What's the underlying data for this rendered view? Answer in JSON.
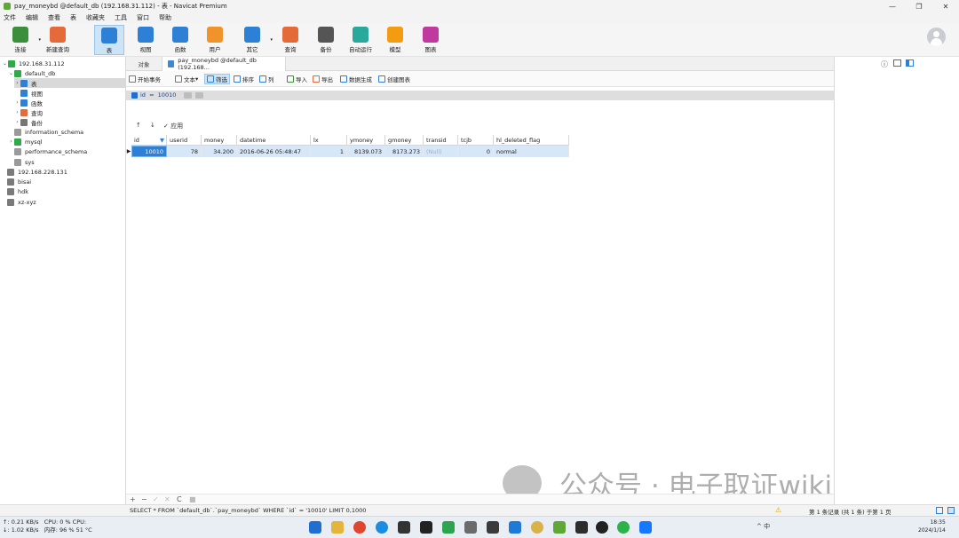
{
  "window": {
    "title": "pay_moneybd @default_db (192.168.31.112) - 表 - Navicat Premium",
    "min": "—",
    "max": "❐",
    "close": "✕"
  },
  "menu": [
    "文件",
    "编辑",
    "查看",
    "表",
    "收藏夹",
    "工具",
    "窗口",
    "帮助"
  ],
  "toolbar": [
    {
      "label": "连接",
      "icon": "plug-icon",
      "color": "#3c8e3c"
    },
    {
      "label": "新建查询",
      "icon": "new-query-icon",
      "color": "#e56a3a"
    },
    {
      "label": "表",
      "icon": "table-icon",
      "color": "#2e7fd6"
    },
    {
      "label": "视图",
      "icon": "view-icon",
      "color": "#2e7fd6"
    },
    {
      "label": "函数",
      "icon": "function-icon",
      "color": "#2e7fd6"
    },
    {
      "label": "用户",
      "icon": "user-icon",
      "color": "#f0932b"
    },
    {
      "label": "其它",
      "icon": "tools-icon",
      "color": "#2e7fd6"
    },
    {
      "label": "查询",
      "icon": "query-icon",
      "color": "#e56a3a"
    },
    {
      "label": "备份",
      "icon": "backup-icon",
      "color": "#555555"
    },
    {
      "label": "自动运行",
      "icon": "robot-icon",
      "color": "#2aa89b"
    },
    {
      "label": "模型",
      "icon": "model-icon",
      "color": "#f39c12"
    },
    {
      "label": "图表",
      "icon": "chart-icon",
      "color": "#c0399f"
    }
  ],
  "tree": [
    {
      "label": "192.168.31.112",
      "icon": "server-green-icon",
      "color": "#2eaa4a"
    },
    {
      "label": "default_db",
      "icon": "database-green-icon",
      "color": "#2eaa4a"
    },
    {
      "label": "表",
      "icon": "tables-icon",
      "color": "#2e7fd6"
    },
    {
      "label": "视图",
      "icon": "views-icon",
      "color": "#2e7fd6"
    },
    {
      "label": "函数",
      "icon": "functions-icon",
      "color": "#2e7fd6"
    },
    {
      "label": "查询",
      "icon": "queries-icon",
      "color": "#e56a3a"
    },
    {
      "label": "备份",
      "icon": "backups-icon",
      "color": "#777777"
    },
    {
      "label": "information_schema",
      "icon": "database-gray-icon",
      "color": "#9a9a9a"
    },
    {
      "label": "mysql",
      "icon": "database-green-icon",
      "color": "#2eaa4a"
    },
    {
      "label": "performance_schema",
      "icon": "database-gray-icon",
      "color": "#9a9a9a"
    },
    {
      "label": "sys",
      "icon": "database-gray-icon",
      "color": "#9a9a9a"
    },
    {
      "label": "192.168.228.131",
      "icon": "server-gray-icon",
      "color": "#7a7a7a"
    },
    {
      "label": "bisai",
      "icon": "server-gray-icon",
      "color": "#7a7a7a"
    },
    {
      "label": "hdk",
      "icon": "server-gray-icon",
      "color": "#7a7a7a"
    },
    {
      "label": "xz-xyz",
      "icon": "server-gray-icon",
      "color": "#7a7a7a"
    }
  ],
  "tabs": {
    "objects": "对象",
    "main": "pay_moneybd @default_db (192.168..."
  },
  "subtoolbar": [
    "开始事务",
    "文本",
    "筛选",
    "排序",
    "列",
    "导入",
    "导出",
    "数据生成",
    "创建图表"
  ],
  "filter": {
    "field": "id",
    "op": "=",
    "value": "10010"
  },
  "sortbar": {
    "up": "↑",
    "down": "↓",
    "apply": "✓ 应用"
  },
  "grid": {
    "columns": [
      "id",
      "userid",
      "money",
      "datetime",
      "lx",
      "ymoney",
      "gmoney",
      "transid",
      "tcjb",
      "hl_deleted_flag"
    ],
    "rows": [
      [
        "10010",
        "78",
        "34.200",
        "2016-06-26 05:48:47",
        "1",
        "8139.073",
        "8173.273",
        "(Null)",
        "0",
        "normal"
      ]
    ]
  },
  "bottomnav": [
    "+",
    "−",
    "✓",
    "✕",
    "C",
    "■"
  ],
  "status": {
    "sql": "SELECT * FROM `default_db`.`pay_moneybd` WHERE `id` = '10010' LIMIT 0,1000",
    "records": "第 1 条记录 (共 1 条) 于第 1 页"
  },
  "watermark": "公众号 · 电子取证wiki",
  "perf": {
    "upload": "↑: 0.21 KB/s",
    "download": "↓: 1.02 KB/s",
    "cpu": "CPU: 0 %   CPU:",
    "mem": "内存: 96 %  51 °C"
  },
  "clock": {
    "time": "18:35",
    "date": "2024/1/14"
  },
  "tray": "^  中"
}
